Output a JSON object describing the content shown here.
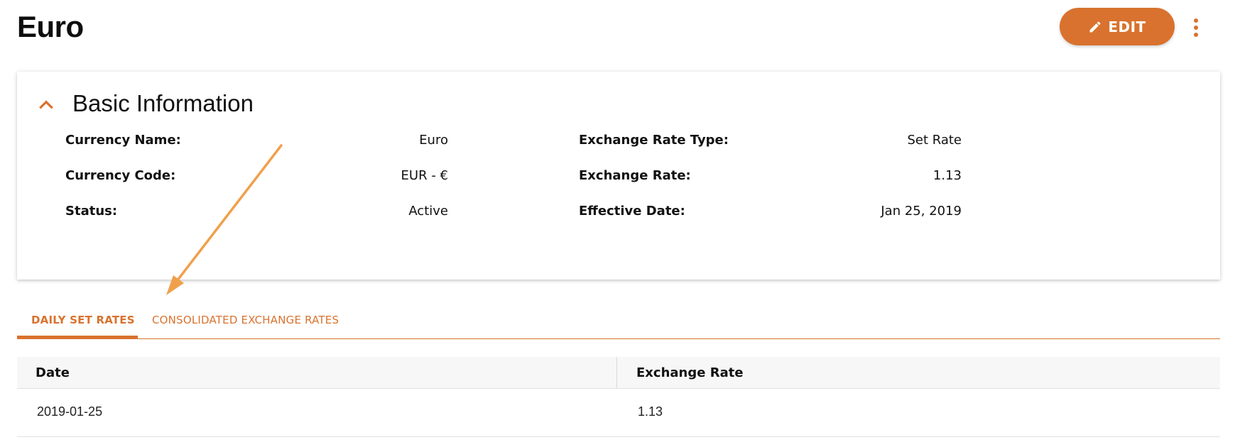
{
  "page": {
    "title": "Euro"
  },
  "header": {
    "edit_label": "EDIT",
    "more_icon": "more-vert-icon"
  },
  "colors": {
    "accent": "#d9722e",
    "annotation_arrow": "#f0a04b"
  },
  "basic_info": {
    "title": "Basic Information",
    "collapse_icon": "chevron-up-icon",
    "fields": [
      {
        "label": "Currency Name:",
        "value": "Euro"
      },
      {
        "label": "Currency Code:",
        "value": "EUR - €"
      },
      {
        "label": "Status:",
        "value": "Active"
      },
      {
        "label": "Exchange Rate Type:",
        "value": "Set Rate"
      },
      {
        "label": "Exchange Rate:",
        "value": "1.13"
      },
      {
        "label": "Effective Date:",
        "value": "Jan 25, 2019"
      }
    ]
  },
  "tabs": [
    {
      "label": "DAILY SET RATES",
      "active": true
    },
    {
      "label": "CONSOLIDATED EXCHANGE RATES",
      "active": false
    }
  ],
  "table": {
    "columns": [
      "Date",
      "Exchange Rate"
    ],
    "rows": [
      [
        "2019-01-25",
        "1.13"
      ]
    ]
  }
}
